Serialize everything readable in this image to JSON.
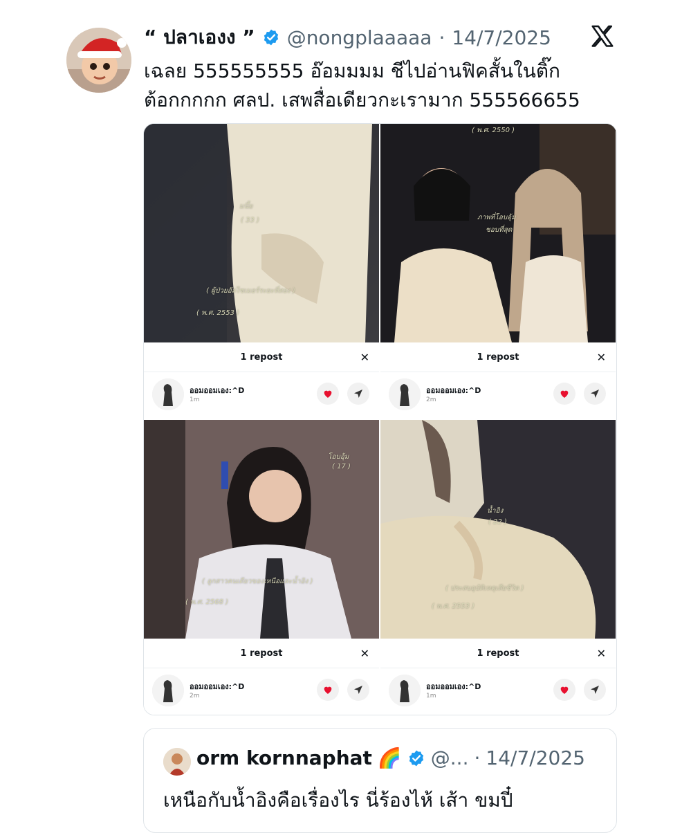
{
  "tweet": {
    "display_name": "“ ปลาเองง ”",
    "handle": "@nongplaaaaa",
    "separator": "·",
    "date": "14/7/2025",
    "text": "เฉลย 555555555 อ๊อมมมม ชีไปอ่านฟิคสั้นในติ๊ก\nต้อกกกกก ศลป. เสพสื่อเดียวกะเรามาก 555566655",
    "avatar_icon": "santa-baby-avatar",
    "verified_icon": "verified-badge-icon",
    "logo_icon": "x-logo-icon",
    "verified_color": "#1d9bf0"
  },
  "media": {
    "panels": [
      {
        "title": "1 repost",
        "close": "✕",
        "user": "ออมออมเอง:^D",
        "time": "1m",
        "captions": [
          "มนึ้ย",
          "( 33 )",
          "( ผู้ป่วยอัลไซเมอร์ระยะที่สอง )",
          "( พ.ศ. 2553 )"
        ]
      },
      {
        "title": "1 repost",
        "close": "✕",
        "user": "ออมออมเอง:^D",
        "time": "2m",
        "captions": [
          "( พ.ศ. 2550 )",
          "ภาพที่โอบอุ้ม",
          "ชอบที่สุด"
        ]
      },
      {
        "title": "1 repost",
        "close": "✕",
        "user": "ออมออมเอง:^D",
        "time": "2m",
        "captions": [
          "โอบอุ้ม",
          "( 17 )",
          "( ลูกสาวคนเดียวของเหนือและน้ำอิง )",
          "( พ.ศ. 2568 )"
        ]
      },
      {
        "title": "1 repost",
        "close": "✕",
        "user": "ออมออมเอง:^D",
        "time": "1m",
        "captions": [
          "น้ำอิง",
          "( 22 )",
          "( ประสบอุบัติเหตุเสียชีวิต )",
          "( พ.ศ. 2553 )"
        ]
      }
    ],
    "heart_color": "#e8102f"
  },
  "quote": {
    "display_name": "orm kornnaphat",
    "emoji": "🌈",
    "handle": "@...",
    "separator": "·",
    "date": "14/7/2025",
    "text": "เหนือกับน้ำอิงคือเรื่องไร นี่ร้องไห้ เส้า ขมปี๋"
  }
}
